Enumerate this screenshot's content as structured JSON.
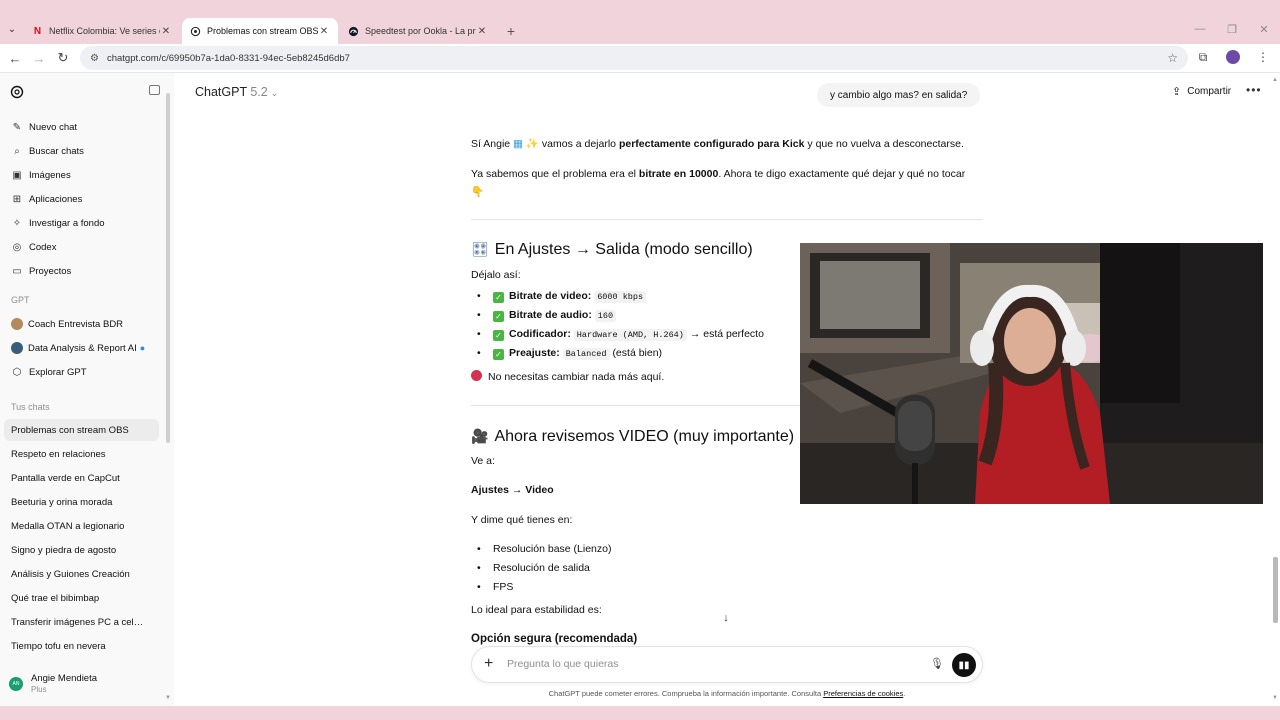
{
  "browser": {
    "tabs": [
      {
        "title": "Netflix Colombia: Ve series onl…",
        "favicon": "N"
      },
      {
        "title": "Problemas con stream OBS",
        "favicon": "gpt"
      },
      {
        "title": "Speedtest por Ookla - La prueb…",
        "favicon": "speed"
      }
    ],
    "active_tab": 1,
    "url": "chatgpt.com/c/69950b7a-1da0-8331-94ec-5eb8245d6db7"
  },
  "sidebar": {
    "primary": [
      {
        "label": "Nuevo chat",
        "icon": "edit-icon"
      },
      {
        "label": "Buscar chats",
        "icon": "search-icon"
      },
      {
        "label": "Imágenes",
        "icon": "image-icon"
      },
      {
        "label": "Aplicaciones",
        "icon": "apps-icon"
      },
      {
        "label": "Investigar a fondo",
        "icon": "research-icon"
      },
      {
        "label": "Codex",
        "icon": "codex-icon"
      },
      {
        "label": "Proyectos",
        "icon": "folder-icon"
      }
    ],
    "gpt_heading": "GPT",
    "gpts": [
      {
        "label": "Coach Entrevista BDR"
      },
      {
        "label": "Data Analysis & Report AI"
      },
      {
        "label": "Explorar GPT"
      }
    ],
    "chats_heading": "Tus chats",
    "chats": [
      "Problemas con stream OBS",
      "Respeto en relaciones",
      "Pantalla verde en CapCut",
      "Beeturia y orina morada",
      "Medalla OTAN a legionario",
      "Signo y piedra de agosto",
      "Análisis y Guiones Creación",
      "Qué trae el bibimbap",
      "Transferir imágenes PC a cel…",
      "Tiempo tofu en nevera"
    ],
    "user": {
      "initials": "AN",
      "name": "Angie Mendieta",
      "plan": "Plus"
    }
  },
  "header": {
    "model": "ChatGPT",
    "version": "5.2",
    "user_message": "y cambio algo mas? en salida?",
    "share": "Compartir"
  },
  "message": {
    "intro_1": "Sí Angie",
    "intro_2": "vamos a dejarlo",
    "intro_bold": "perfectamente configurado para Kick",
    "intro_3": "y que no vuelva a desconectarse.",
    "para2_a": "Ya sabemos que el problema era el",
    "para2_bold": "bitrate en 10000",
    "para2_b": ". Ahora te digo exactamente qué dejar y qué no tocar",
    "h_salida": "En Ajustes → Salida (modo sencillo)",
    "dejalo": "Déjalo así:",
    "settings": [
      {
        "label": "Bitrate de video:",
        "code": "6000 kbps",
        "after": ""
      },
      {
        "label": "Bitrate de audio:",
        "code": "160",
        "after": ""
      },
      {
        "label": "Codificador:",
        "code": "Hardware (AMD, H.264)",
        "after": "→ está perfecto"
      },
      {
        "label": "Preajuste:",
        "code": "Balanced",
        "after": "(está bien)"
      }
    ],
    "no_change": "No necesitas cambiar nada más aquí.",
    "h_video": "Ahora revisemos VIDEO (muy importante)",
    "ve_a": "Ve a:",
    "path": "Ajustes → Video",
    "dime": "Y dime qué tienes en:",
    "video_items": [
      "Resolución base (Lienzo)",
      "Resolución de salida",
      "FPS"
    ],
    "ideal": "Lo ideal para estabilidad es:",
    "option": "Opción segura (recomendada)"
  },
  "composer": {
    "placeholder": "Pregunta lo que quieras"
  },
  "footer": {
    "text": "ChatGPT puede cometer errores. Comprueba la información importante. Consulta",
    "link": "Preferencias de cookies",
    "end": "."
  }
}
